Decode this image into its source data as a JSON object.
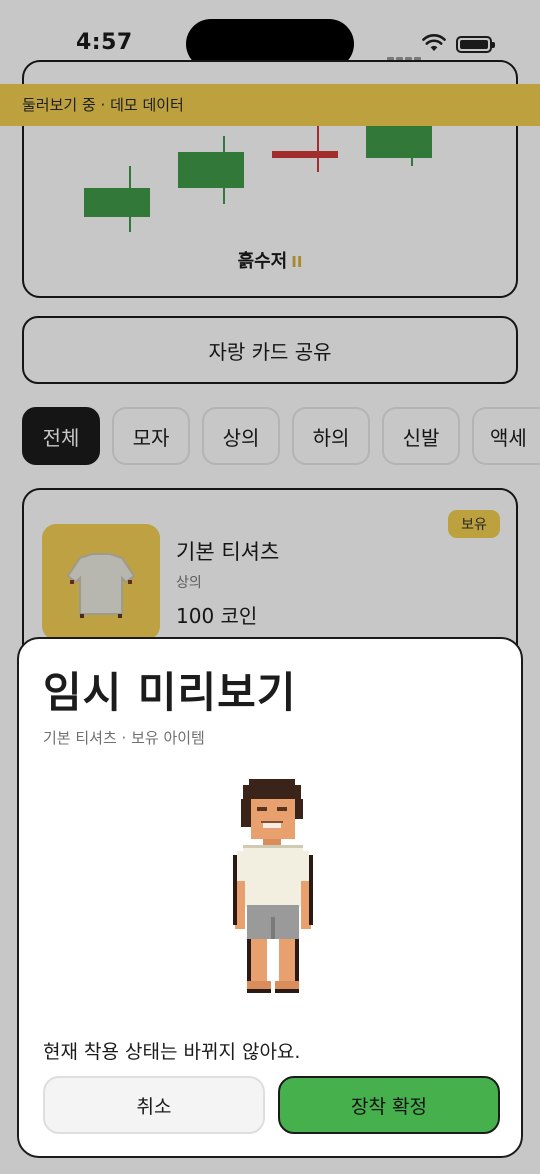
{
  "status_bar": {
    "time": "4:57"
  },
  "banner": {
    "text": "둘러보기 중 · 데모 데이터"
  },
  "chart_card": {
    "caption": "흙수저",
    "pause_symbol": "II"
  },
  "share_button": {
    "label": "자랑 카드 공유"
  },
  "categories": [
    {
      "label": "전체",
      "active": true
    },
    {
      "label": "모자",
      "active": false
    },
    {
      "label": "상의",
      "active": false
    },
    {
      "label": "하의",
      "active": false
    },
    {
      "label": "신발",
      "active": false
    },
    {
      "label": "액세",
      "active": false
    }
  ],
  "item": {
    "name": "기본 티셔츠",
    "category": "상의",
    "price": "100 코인",
    "badge": "보유"
  },
  "preview_sheet": {
    "title": "임시 미리보기",
    "subtitle": "기본 티셔츠 · 보유 아이템",
    "note": "현재 착용 상태는 바뀌지 않아요.",
    "cancel_label": "취소",
    "confirm_label": "장착 확정"
  },
  "colors": {
    "candle_up": "#3f9a4a",
    "candle_down": "#cf3a3a",
    "banner_bg": "#f1cf50",
    "confirm_bg": "#46b04c"
  }
}
